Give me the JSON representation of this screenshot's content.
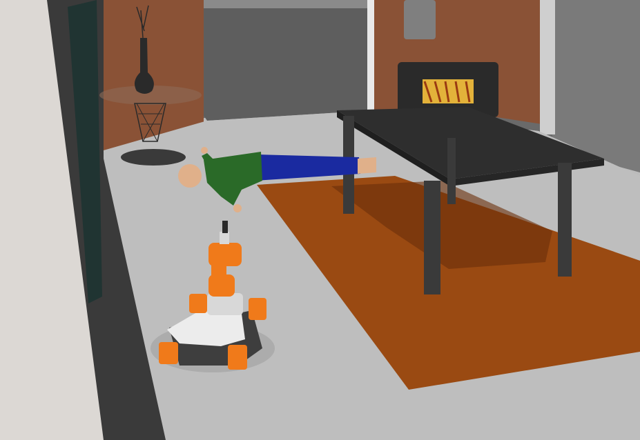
{
  "scene": {
    "colors": {
      "floor": "#bcbcbc",
      "left_wall": "#d9d6d3",
      "accent_wall": "#8a5236",
      "back_wall": "#6b6b6b",
      "rug": "#9a4a12",
      "table": "#2e2e2e",
      "robot_accent": "#f07a1a",
      "robot_body": "#3e3e3e",
      "shirt": "#2a6a28",
      "pants": "#1a2aa0",
      "skin": "#e8b68a"
    },
    "icons": [
      "robot-icon",
      "person-icon",
      "table-icon",
      "vase-icon",
      "chair-icon"
    ]
  }
}
